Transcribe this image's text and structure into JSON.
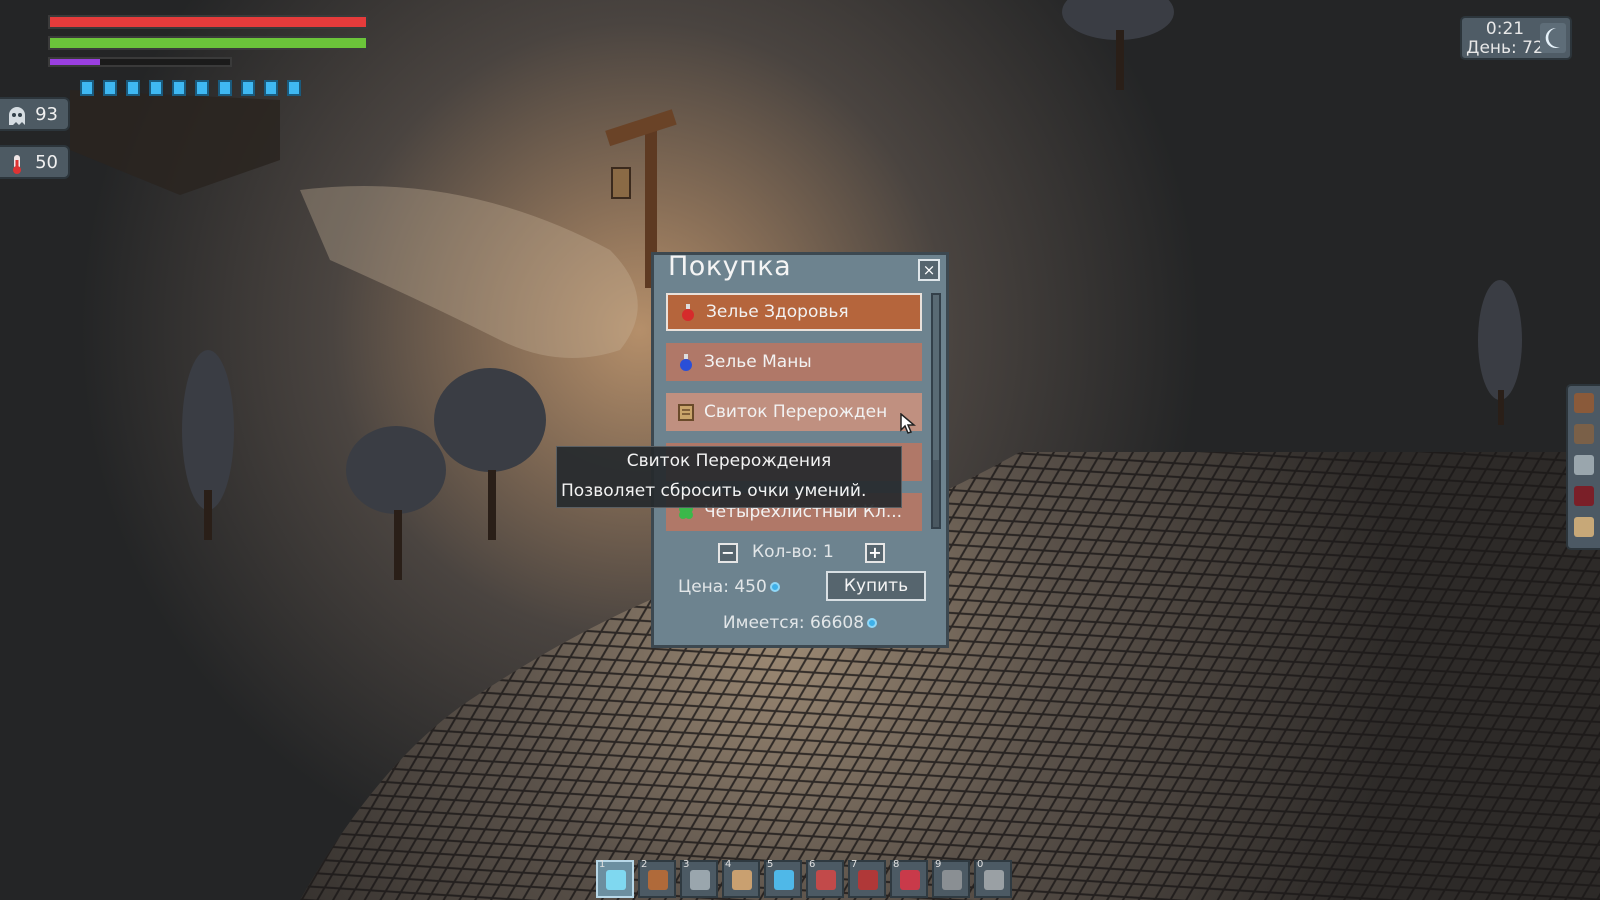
{
  "colors": {
    "health": "#e53b3b",
    "stamina": "#6bc43a",
    "experience": "#9a3fe0",
    "mana_pip": "#3fb8f2",
    "shop_panel": "#6d838f",
    "item_selected": "#b5653c",
    "item_normal": "#b7806e"
  },
  "hud": {
    "health_level": 1.0,
    "stamina_level": 1.0,
    "experience_level": 0.28,
    "mana_pips": 10,
    "stats": [
      {
        "icon": "ghost-icon",
        "value": "93"
      },
      {
        "icon": "thermometer-icon",
        "value": "50"
      }
    ],
    "clock": {
      "time": "0:21",
      "day": "День: 72",
      "icon": "moon-icon"
    }
  },
  "side_tools": [
    "backpack-icon",
    "hammer-icon",
    "plus-icon",
    "book-icon",
    "map-icon"
  ],
  "shop": {
    "title": "Покупка",
    "close_label": "×",
    "items": [
      {
        "name": "Зелье Здоровья",
        "icon": "health-potion-icon",
        "selected": true
      },
      {
        "name": "Зелье Маны",
        "icon": "mana-potion-icon",
        "selected": false
      },
      {
        "name": "Свиток Перерожден",
        "icon": "scroll-icon",
        "selected": false
      },
      {
        "name": "",
        "icon": "hidden-item-icon",
        "selected": false
      },
      {
        "name": "Четырехлистный Кл...",
        "icon": "clover-icon",
        "selected": false
      }
    ],
    "minus_label": "−",
    "plus_label": "+",
    "quantity_label": "Кол-во: 1",
    "price_label": "Цена: 450",
    "buy_label": "Купить",
    "have_label": "Имеется: 66608"
  },
  "tooltip": {
    "title": "Свиток Перерождения",
    "description": "Позволяет сбросить очки умений."
  },
  "hotbar": [
    {
      "number": "1",
      "icon": "sword-icon",
      "active": true
    },
    {
      "number": "2",
      "icon": "pickaxe-icon",
      "active": false
    },
    {
      "number": "3",
      "icon": "wand-icon",
      "active": false
    },
    {
      "number": "4",
      "icon": "hoe-icon",
      "active": false
    },
    {
      "number": "5",
      "icon": "crystal-icon",
      "active": false
    },
    {
      "number": "6",
      "icon": "fish-icon",
      "active": false
    },
    {
      "number": "7",
      "icon": "shield-icon",
      "active": false
    },
    {
      "number": "8",
      "icon": "heart-icon",
      "active": false
    },
    {
      "number": "9",
      "icon": "boat-icon",
      "active": false
    },
    {
      "number": "0",
      "icon": "trap-icon",
      "active": false
    }
  ]
}
